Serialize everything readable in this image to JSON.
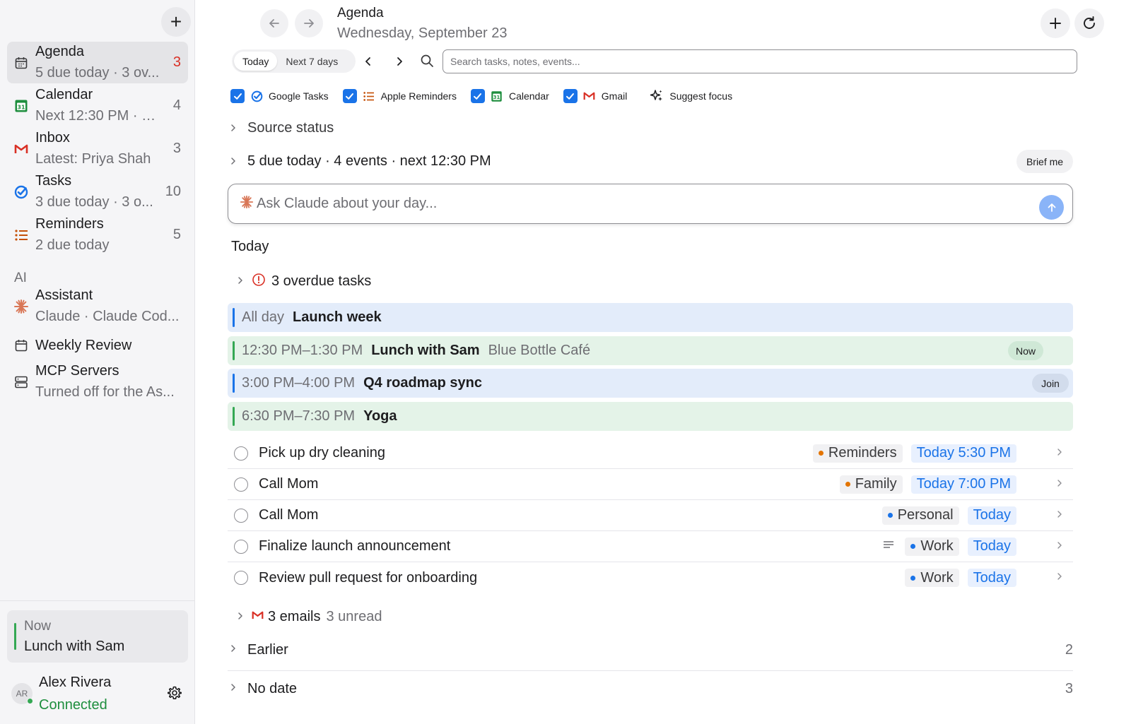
{
  "sidebar": {
    "items": [
      {
        "title": "Agenda",
        "subtitle": "5 due today · 3 ov...",
        "count": "3",
        "icon": "calendar-outline-icon"
      },
      {
        "title": "Calendar",
        "subtitle": "Next 12:30 PM · L...",
        "count": "4",
        "icon": "google-calendar-icon"
      },
      {
        "title": "Inbox",
        "subtitle": "Latest: Priya Shah",
        "count": "3",
        "icon": "gmail-icon"
      },
      {
        "title": "Tasks",
        "subtitle": "3 due today · 3 o...",
        "count": "10",
        "icon": "google-tasks-icon"
      },
      {
        "title": "Reminders",
        "subtitle": "2 due today",
        "count": "5",
        "icon": "reminders-list-icon"
      }
    ],
    "section_ai": "AI",
    "ai_items": [
      {
        "title": "Assistant",
        "subtitle": "Claude · Claude Cod...",
        "icon": "claude-spark-icon"
      },
      {
        "title": "Weekly Review",
        "icon": "calendar-outline-icon"
      },
      {
        "title": "MCP Servers",
        "subtitle": "Turned off for the As...",
        "icon": "server-icon"
      }
    ],
    "now_card": {
      "label": "Now",
      "title": "Lunch with Sam"
    },
    "user": {
      "initials": "AR",
      "name": "Alex Rivera",
      "status": "Connected"
    }
  },
  "header": {
    "title": "Agenda",
    "date": "Wednesday, September 23"
  },
  "toolbar": {
    "segments": [
      "Today",
      "Next 7 days"
    ],
    "selected_segment": "Today",
    "search_placeholder": "Search tasks, notes, events..."
  },
  "filters": [
    {
      "label": "Google Tasks",
      "checked": true,
      "icon": "google-tasks-icon"
    },
    {
      "label": "Apple Reminders",
      "checked": true,
      "icon": "reminders-list-icon"
    },
    {
      "label": "Calendar",
      "checked": true,
      "icon": "google-calendar-icon"
    },
    {
      "label": "Gmail",
      "checked": true,
      "icon": "gmail-icon"
    }
  ],
  "suggest_focus": "Suggest focus",
  "source_status": "Source status",
  "summary": {
    "text": "5 due today · 4 events · next 12:30 PM",
    "brief_label": "Brief me"
  },
  "ask": {
    "placeholder": "Ask Claude about your day..."
  },
  "today_heading": "Today",
  "overdue": {
    "label": "3 overdue tasks"
  },
  "events": [
    {
      "time": "All day",
      "title": "Launch week",
      "location": "",
      "pill": "",
      "color": "#1a73e8"
    },
    {
      "time": "12:30 PM–1:30 PM",
      "title": "Lunch with Sam",
      "location": "Blue Bottle Café",
      "pill": "Now",
      "color": "#34a853"
    },
    {
      "time": "3:00 PM–4:00 PM",
      "title": "Q4 roadmap sync",
      "location": "",
      "pill": "Join",
      "color": "#1a73e8"
    },
    {
      "time": "6:30 PM–7:30 PM",
      "title": "Yoga",
      "location": "",
      "pill": "",
      "color": "#34a853"
    }
  ],
  "tasks": [
    {
      "title": "Pick up dry cleaning",
      "list": "Reminders",
      "list_color": "#e37400",
      "due": "Today 5:30 PM",
      "has_notes": false
    },
    {
      "title": "Call Mom",
      "list": "Family",
      "list_color": "#e37400",
      "due": "Today 7:00 PM",
      "has_notes": false
    },
    {
      "title": "Call Mom",
      "list": "Personal",
      "list_color": "#1a73e8",
      "due": "Today",
      "has_notes": false
    },
    {
      "title": "Finalize launch announcement",
      "list": "Work",
      "list_color": "#1a73e8",
      "due": "Today",
      "has_notes": true
    },
    {
      "title": "Review pull request for onboarding",
      "list": "Work",
      "list_color": "#1a73e8",
      "due": "Today",
      "has_notes": false
    }
  ],
  "emails": {
    "label": "3 emails",
    "sub": "3 unread"
  },
  "sections": [
    {
      "label": "Earlier",
      "count": "2"
    },
    {
      "label": "No date",
      "count": "3"
    }
  ]
}
